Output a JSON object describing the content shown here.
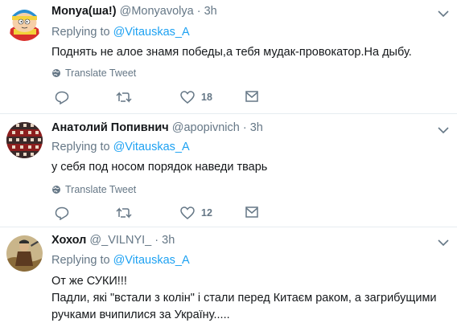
{
  "tweets": [
    {
      "name": "Monya(ша!)",
      "handle": "@Monyavolya",
      "time": "3h",
      "replying_prefix": "Replying to ",
      "replying_to": "@Vitauskas_A",
      "text": "Поднять не алое знамя победы,а тебя мудак-провокатор.На дыбу.",
      "translate": "Translate Tweet",
      "likes": "18"
    },
    {
      "name": "Анатолий Попивнич",
      "handle": "@apopivnich",
      "time": "3h",
      "replying_prefix": "Replying to ",
      "replying_to": "@Vitauskas_A",
      "text": "у себя под носом порядок наведи тварь",
      "translate": "Translate Tweet",
      "likes": "12"
    },
    {
      "name": "Хохол",
      "handle": "@_VILNYI_",
      "time": "3h",
      "replying_prefix": "Replying to ",
      "replying_to": "@Vitauskas_A",
      "text_line1": "От же СУКИ!!!",
      "text_line2": "Падли, які \"встали з колін\" і стали перед Китаєм раком, а загрибущими",
      "text_line3": "ручками вчипилися за Україну....."
    }
  ],
  "separator": "·",
  "colors": {
    "accent": "#1da1f2",
    "muted": "#657786",
    "text": "#14171a",
    "border": "#e6ecf0"
  },
  "icons": [
    "reply-icon",
    "retweet-icon",
    "like-icon",
    "direct-message-icon",
    "globe-icon",
    "chevron-down-icon"
  ]
}
